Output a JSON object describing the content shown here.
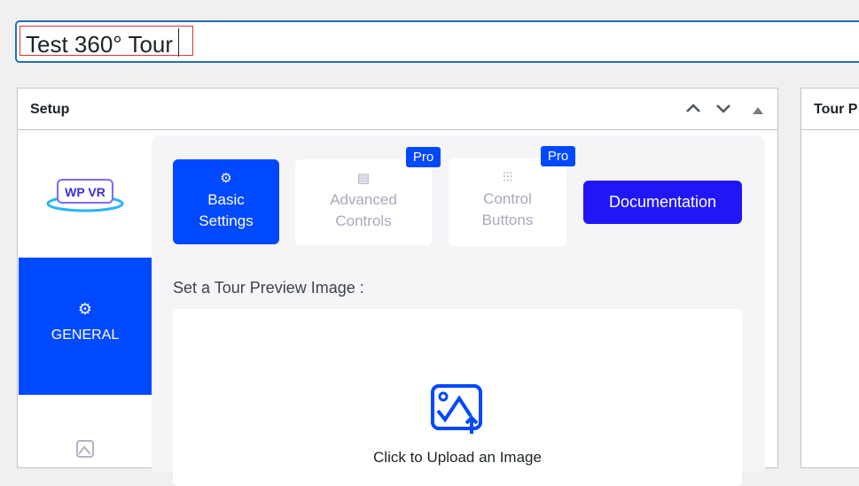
{
  "title_input": {
    "value": "Test 360° Tour"
  },
  "setup": {
    "heading": "Setup"
  },
  "sidebar": {
    "logo_text": "WP VR",
    "items": [
      {
        "label": "GENERAL",
        "active": true
      }
    ]
  },
  "tabs": [
    {
      "label1": "Basic",
      "label2": "Settings",
      "icon": "gear-icon"
    },
    {
      "label1": "Advanced",
      "label2": "Controls",
      "icon": "table-icon",
      "badge": "Pro"
    },
    {
      "label1": "Control",
      "label2": "Buttons",
      "icon": "sliders-icon",
      "badge": "Pro"
    }
  ],
  "documentation_label": "Documentation",
  "preview": {
    "label": "Set a Tour Preview Image :",
    "upload_text": "Click to Upload an Image"
  },
  "right_panel": {
    "heading": "Tour P"
  },
  "colors": {
    "accent": "#0049ff",
    "docs": "#2116f6"
  }
}
